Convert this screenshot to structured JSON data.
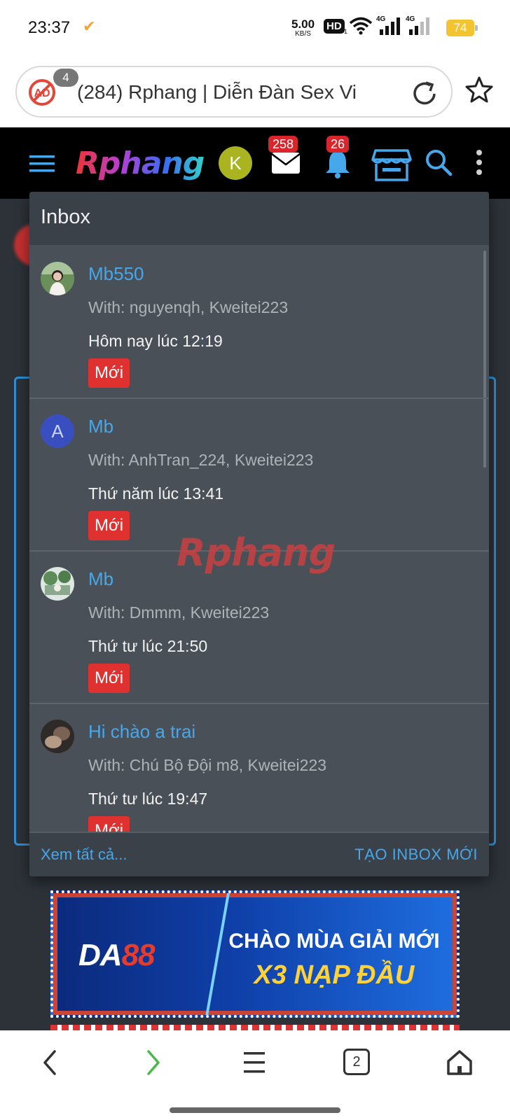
{
  "status_bar": {
    "time": "23:37",
    "network_speed": "5.00",
    "network_speed_unit": "KB/S",
    "hd_label": "HD",
    "hd_sub": "1",
    "signal_1_label": "4G",
    "signal_2_label": "4G",
    "battery": "74"
  },
  "browser": {
    "adblock_count": "4",
    "url_text": "(284) Rphang | Diễn Đàn Sex Vi"
  },
  "site_header": {
    "logo": "Rphang",
    "user_avatar_letter": "K",
    "messages_count": "258",
    "notifications_count": "26"
  },
  "inbox": {
    "title": "Inbox",
    "messages": [
      {
        "title": "Mb550",
        "with": "With: nguyenqh, Kweitei223",
        "time": "Hôm nay lúc 12:19",
        "badge": "Mới"
      },
      {
        "title": "Mb",
        "with": "With: AnhTran_224, Kweitei223",
        "time": "Thứ năm lúc 13:41",
        "badge": "Mới",
        "avatar_letter": "A"
      },
      {
        "title": "Mb",
        "with": "With: Dmmm, Kweitei223",
        "time": "Thứ tư lúc 21:50",
        "badge": "Mới"
      },
      {
        "title": "Hi chào a trai",
        "with": "With: Chú Bộ Đội m8, Kweitei223",
        "time": "Thứ tư lúc 19:47",
        "badge": "Mới"
      }
    ],
    "see_all": "Xem tất cả...",
    "new_inbox": "TẠO INBOX MỚI"
  },
  "watermark": "Rphang",
  "ad": {
    "brand_da": "DA",
    "brand_num": "88",
    "line1": "CHÀO MÙA GIẢI MỚI",
    "line2": "X3 NẠP ĐẦU"
  },
  "bottom_nav": {
    "tab_count": "2"
  }
}
